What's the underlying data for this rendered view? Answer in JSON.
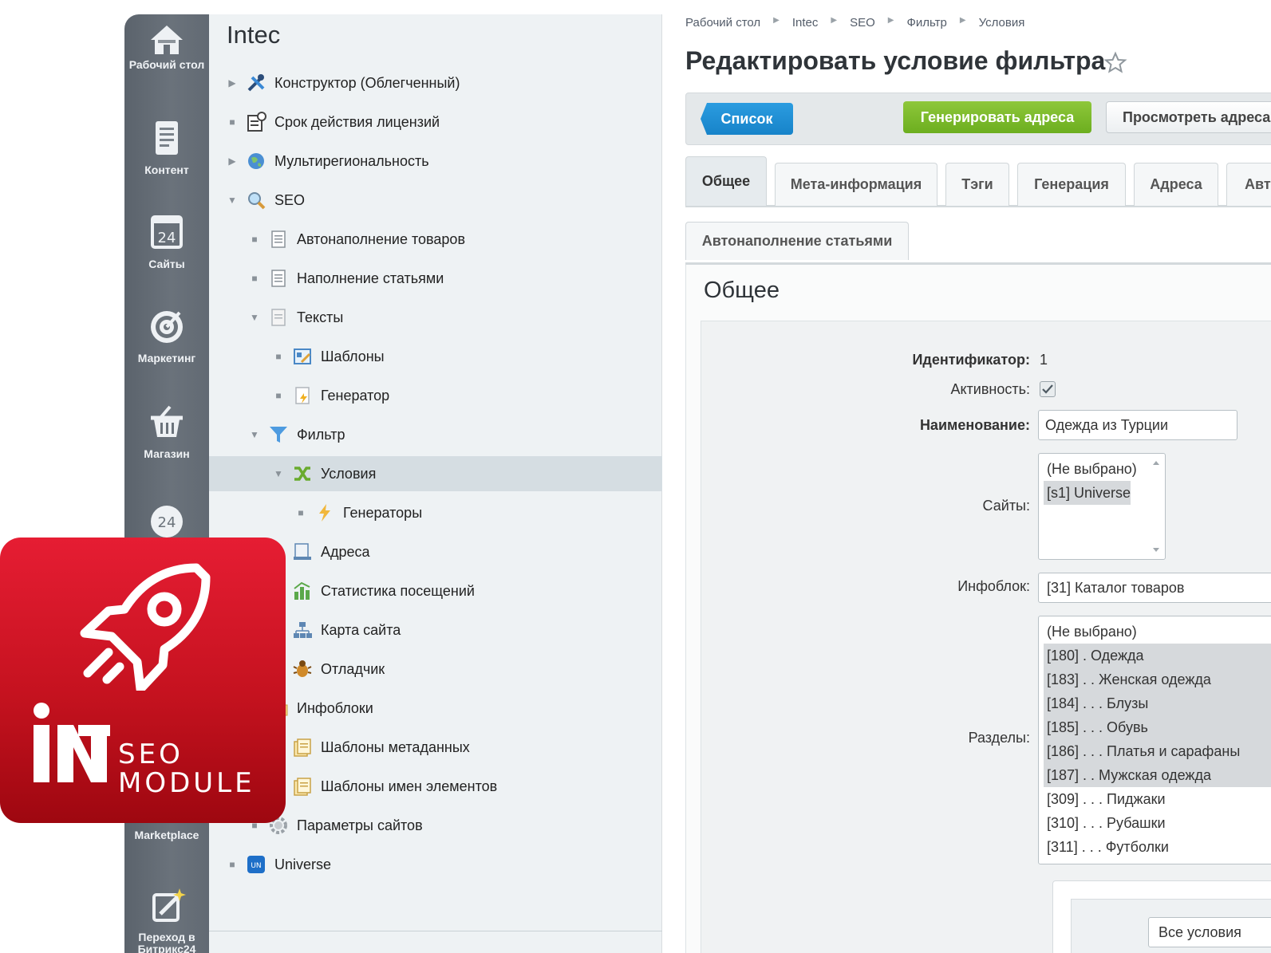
{
  "rail": {
    "items": [
      {
        "label": "Рабочий стол",
        "icon": "home-icon"
      },
      {
        "label": "Контент",
        "icon": "document-icon"
      },
      {
        "label": "Сайты",
        "icon": "calendar-24-icon"
      },
      {
        "label": "Маркетинг",
        "icon": "target-icon"
      },
      {
        "label": "Магазин",
        "icon": "basket-icon"
      },
      {
        "label": "",
        "icon": "bitrix24-cloud-icon"
      },
      {
        "label": "Marketplace",
        "icon": "marketplace-icon"
      },
      {
        "label": "Переход в Битрикс24",
        "icon": "magic-pen-icon"
      }
    ]
  },
  "tree": {
    "title": "Intec",
    "nodes": [
      {
        "label": "Конструктор (Облегченный)",
        "icon": "tools-icon"
      },
      {
        "label": "Срок действия лицензий",
        "icon": "license-icon"
      },
      {
        "label": "Мультирегиональность",
        "icon": "globe-icon"
      },
      {
        "label": "SEO",
        "icon": "magnifier-icon"
      },
      {
        "label": "Автонаполнение товаров",
        "icon": "page-icon"
      },
      {
        "label": "Наполнение статьями",
        "icon": "page-icon"
      },
      {
        "label": "Тексты",
        "icon": "page-icon"
      },
      {
        "label": "Шаблоны",
        "icon": "template-icon"
      },
      {
        "label": "Генератор",
        "icon": "generator-icon"
      },
      {
        "label": "Фильтр",
        "icon": "funnel-icon"
      },
      {
        "label": "Условия",
        "icon": "shuffle-icon"
      },
      {
        "label": "Генераторы",
        "icon": "lightning-icon"
      },
      {
        "label": "Адреса",
        "icon": "address-icon"
      },
      {
        "label": "Статистика посещений",
        "icon": "stats-icon"
      },
      {
        "label": "Карта сайта",
        "icon": "sitemap-icon"
      },
      {
        "label": "Отладчик",
        "icon": "bug-icon"
      },
      {
        "label": "Инфоблоки",
        "icon": "folder-icon"
      },
      {
        "label": "Шаблоны метаданных",
        "icon": "meta-template-icon"
      },
      {
        "label": "Шаблоны имен элементов",
        "icon": "meta-template-icon"
      },
      {
        "label": "Параметры сайтов",
        "icon": "gear-icon"
      },
      {
        "label": "Universe",
        "icon": "universe-icon"
      }
    ]
  },
  "breadcrumb": [
    "Рабочий стол",
    "Intec",
    "SEO",
    "Фильтр",
    "Условия"
  ],
  "page_title": "Редактировать условие фильтра",
  "toolbar": {
    "list_label": "Список",
    "generate_label": "Генерировать адреса",
    "view_label": "Просмотреть адреса"
  },
  "tabs": [
    "Общее",
    "Мета-информация",
    "Тэги",
    "Генерация",
    "Адреса",
    "Авто"
  ],
  "tabs_row2": [
    "Автонаполнение статьями"
  ],
  "section_title": "Общее",
  "form": {
    "id_label": "Идентификатор:",
    "id_value": "1",
    "active_label": "Активность:",
    "active_checked": true,
    "name_label": "Наименование:",
    "name_value": "Одежда из Турции",
    "sites_label": "Сайты:",
    "sites_options": [
      {
        "text": "(Не выбрано)",
        "selected": false
      },
      {
        "text": "[s1] Universe",
        "selected": true
      }
    ],
    "iblock_label": "Инфоблок:",
    "iblock_value": "[31] Каталог товаров",
    "sections_label": "Разделы:",
    "sections_options": [
      {
        "text": "(Не выбрано)",
        "selected": false
      },
      {
        "text": "[180] . Одежда",
        "selected": true
      },
      {
        "text": "[183] . . Женская одежда",
        "selected": true
      },
      {
        "text": "[184] . . . Блузы",
        "selected": true
      },
      {
        "text": "[185] . . . Обувь",
        "selected": true
      },
      {
        "text": "[186] . . . Платья и сарафаны",
        "selected": true
      },
      {
        "text": "[187] . . Мужская одежда",
        "selected": true
      },
      {
        "text": "[309] . . . Пиджаки",
        "selected": false
      },
      {
        "text": "[310] . . . Рубашки",
        "selected": false
      },
      {
        "text": "[311] . . . Футболки",
        "selected": false
      }
    ],
    "conditions_value": "Все условия"
  },
  "badge": {
    "logo_text": "IN",
    "line1": "SEO",
    "line2": "MODULE"
  },
  "colors": {
    "rail": "#636b74",
    "tree_bg": "#eef2f4",
    "btn_blue": "#1e8fd6",
    "btn_green": "#7ab92b",
    "badge_red": "#d4151f"
  }
}
